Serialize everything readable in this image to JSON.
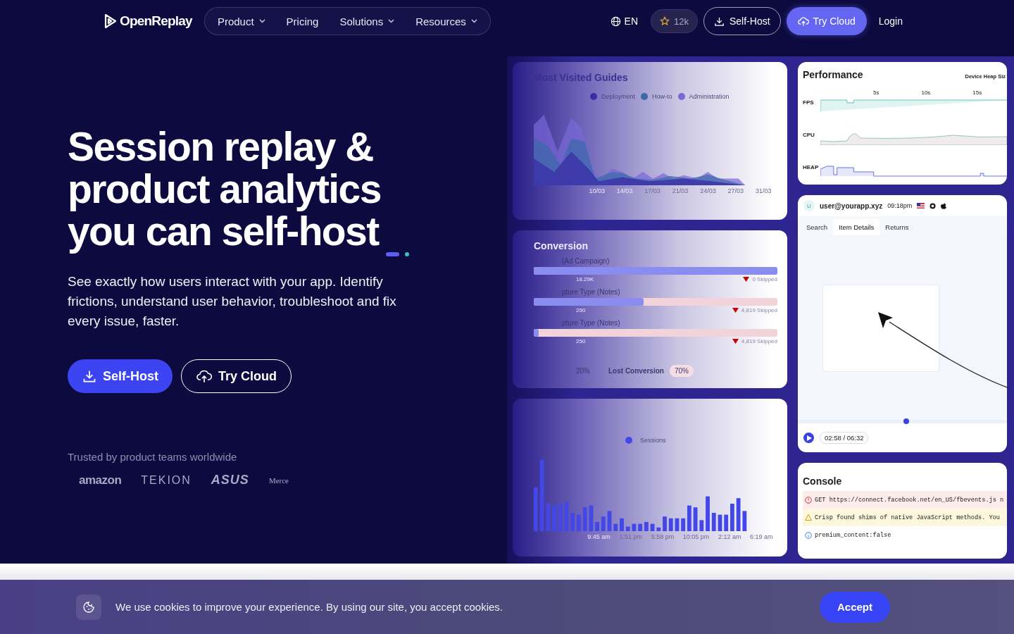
{
  "nav": {
    "logo": "OpenReplay",
    "menu": [
      {
        "label": "Product",
        "dropdown": true
      },
      {
        "label": "Pricing",
        "dropdown": false
      },
      {
        "label": "Solutions",
        "dropdown": true
      },
      {
        "label": "Resources",
        "dropdown": true
      }
    ],
    "language": "EN",
    "stars": "12k",
    "self_host": "Self-Host",
    "try_cloud": "Try Cloud",
    "login": "Login"
  },
  "hero": {
    "title_lines": [
      "Session replay &",
      "product analytics",
      "you can self-host"
    ],
    "subtitle": "See exactly how users interact with your app. Identify frictions, understand user behavior, troubleshoot and fix every issue, faster.",
    "buttons": [
      {
        "kind": "primary",
        "label": "Self-Host"
      },
      {
        "kind": "outline",
        "label": "Try Cloud"
      }
    ],
    "trusted": "Trusted by product teams worldwide",
    "logos": [
      "amazon",
      "TEKION",
      "ASUS",
      "Merce"
    ]
  },
  "dashboard": {
    "guides": {
      "title": "Most Visited Guides",
      "legend": [
        {
          "label": "Deployment",
          "color": "#3b2fa8"
        },
        {
          "label": "How-to",
          "color": "#3a6aa8"
        },
        {
          "label": "Administration",
          "color": "#7b68d8"
        }
      ],
      "x_labels": [
        "10/03",
        "14/03",
        "17/03",
        "21/03",
        "24/03",
        "27/03",
        "31/03"
      ]
    },
    "conversion": {
      "title": "Conversion",
      "steps": [
        {
          "label": "(Ad Campaign)",
          "count": "18.29K",
          "skipped": "0 Skipped",
          "level": 1
        },
        {
          "label": "pture Type (Notes)",
          "count": "250",
          "skipped": "4,819 Skipped",
          "level": 0.45
        },
        {
          "label": "pture Type (Notes)",
          "count": "250",
          "skipped": "4,819 Skipped",
          "level": 0.02
        }
      ],
      "footer": [
        "20%",
        "Lost Conversion",
        "70%"
      ]
    },
    "sessions": {
      "legend": {
        "label": "Sessions",
        "color": "#4347e8"
      },
      "x_labels": [
        "9:45 am",
        "1:51 pm",
        "5:58 pm",
        "10:05 pm",
        "2:12 am",
        "6:19 am"
      ]
    },
    "performance": {
      "title": "Performance",
      "heap_label": "Device Heap Siz",
      "rows": [
        "FPS",
        "CPU",
        "HEAP"
      ],
      "ticks": [
        "5s",
        "10s",
        "15s"
      ]
    },
    "session": {
      "avatar": "U",
      "user": "user@yourapp.xyz",
      "time": "09:18pm",
      "tabs": [
        {
          "label": "Search",
          "selected": false
        },
        {
          "label": "Item Details",
          "selected": true
        },
        {
          "label": "Returns",
          "selected": false
        }
      ],
      "progress": {
        "level": 0.52
      },
      "timer": "02:58 / 06:32"
    },
    "console": {
      "title": "Console",
      "entries": [
        {
          "kind": "error",
          "text": "GET https://connect.facebook.net/en_US/fbevents.js n"
        },
        {
          "kind": "warning",
          "text": "Crisp found shims of native JavaScript methods. You"
        },
        {
          "kind": "info",
          "text": "premium_content:false"
        }
      ]
    }
  },
  "cookie": {
    "text": "We use cookies to improve your experience. By using our site, you accept cookies.",
    "button": "Accept"
  }
}
